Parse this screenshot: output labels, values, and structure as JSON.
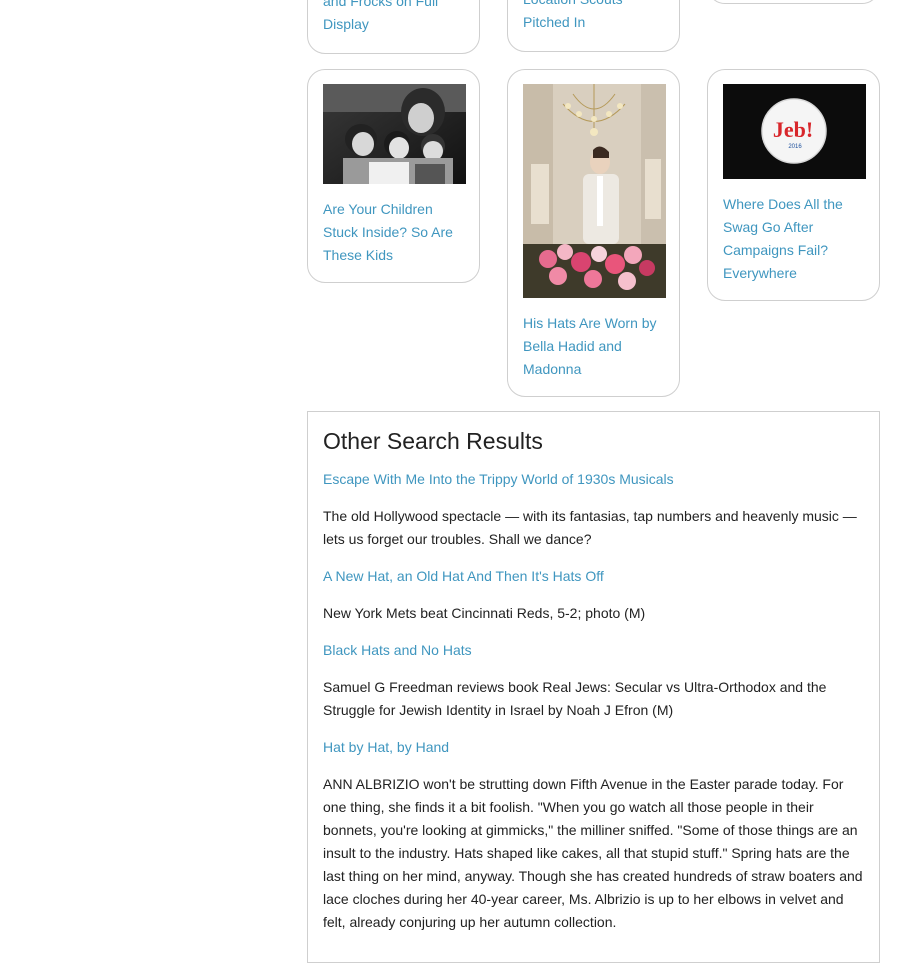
{
  "top_cards": [
    {
      "title": "and Frocks on Full Display"
    },
    {
      "title": "Location Scouts Pitched In"
    },
    {
      "title": ""
    }
  ],
  "cards": [
    {
      "title": "Are Your Children Stuck Inside? So Are These Kids",
      "image": "black-and-white family photo"
    },
    {
      "title": "His Hats Are Worn by Bella Hadid and Madonna",
      "image": "milliner with flowers under chandelier"
    },
    {
      "title": "Where Does All the Swag Go After Campaigns Fail? Everywhere",
      "image": "Jeb campaign button",
      "button_text": "Jeb!",
      "button_year": "2016"
    }
  ],
  "other_results": {
    "heading": "Other Search Results",
    "items": [
      {
        "title": "Escape With Me Into the Trippy World of 1930s Musicals",
        "summary": "The old Hollywood spectacle — with its fantasias, tap numbers and heavenly music — lets us forget our troubles. Shall we dance?"
      },
      {
        "title": "A New Hat, an Old Hat And Then It's Hats Off",
        "summary": "New York Mets beat Cincinnati Reds, 5-2; photo (M)"
      },
      {
        "title": "Black Hats and No Hats",
        "summary": "Samuel G Freedman reviews book Real Jews: Secular vs Ultra-Orthodox and the Struggle for Jewish Identity in Israel by Noah J Efron (M)"
      },
      {
        "title": "Hat by Hat, by Hand",
        "summary": "ANN ALBRIZIO won't be strutting down Fifth Avenue in the Easter parade today. For one thing, she finds it a bit foolish. \"When you go watch all those people in their bonnets, you're looking at gimmicks,\" the milliner sniffed. \"Some of those things are an insult to the industry. Hats shaped like cakes, all that stupid stuff.\" Spring hats are the last thing on her mind, anyway. Though she has created hundreds of straw boaters and lace cloches during her 40-year career, Ms. Albrizio is up to her elbows in velvet and felt, already conjuring up her autumn collection."
      }
    ]
  },
  "colors": {
    "link": "#3f96bf",
    "text": "#222222",
    "border": "#cfcfcf"
  }
}
